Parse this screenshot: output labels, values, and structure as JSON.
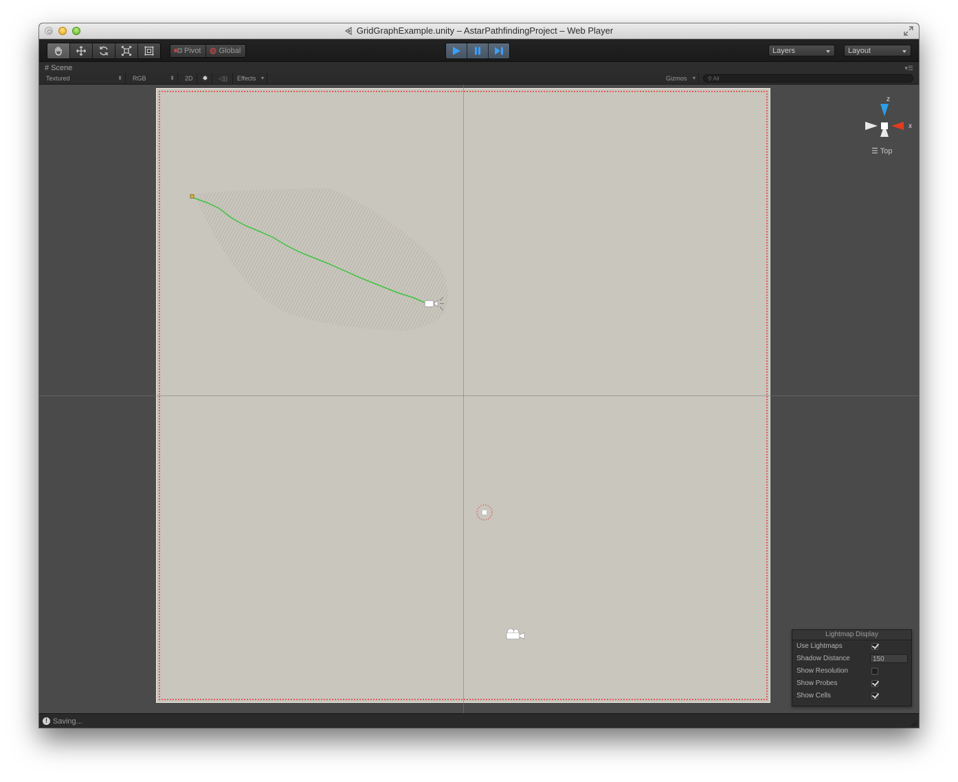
{
  "window": {
    "title": "GridGraphExample.unity – AstarPathfindingProject – Web Player"
  },
  "toolbar": {
    "tools": [
      "hand-icon",
      "move-icon",
      "rotate-icon",
      "scale-icon",
      "rect-icon"
    ],
    "pivot_label": "Pivot",
    "global_label": "Global",
    "playback": [
      "play-icon",
      "pause-icon",
      "step-icon"
    ],
    "layers_label": "Layers",
    "layout_label": "Layout"
  },
  "scene_tab": {
    "label": "Scene"
  },
  "scene_toolbar": {
    "render_mode": "Textured",
    "color_mode": "RGB",
    "mode_2d": "2D",
    "effects_label": "Effects",
    "gizmos_label": "Gizmos",
    "search_placeholder": "All"
  },
  "gizmo": {
    "z_label": "z",
    "x_label": "x",
    "view_label": "Top"
  },
  "lightmap_display": {
    "title": "Lightmap Display",
    "use_lightmaps_label": "Use Lightmaps",
    "use_lightmaps": true,
    "shadow_distance_label": "Shadow Distance",
    "shadow_distance": "150",
    "show_resolution_label": "Show Resolution",
    "show_resolution": false,
    "show_probes_label": "Show Probes",
    "show_probes": true,
    "show_cells_label": "Show Cells",
    "show_cells": true
  },
  "status": {
    "text": "Saving..."
  },
  "colors": {
    "path": "#3cc43c",
    "grid_border": "#df5b5b",
    "accent_play": "#3aa0ff",
    "axis_x": "#e23b1e",
    "axis_z": "#2b9fe8"
  }
}
